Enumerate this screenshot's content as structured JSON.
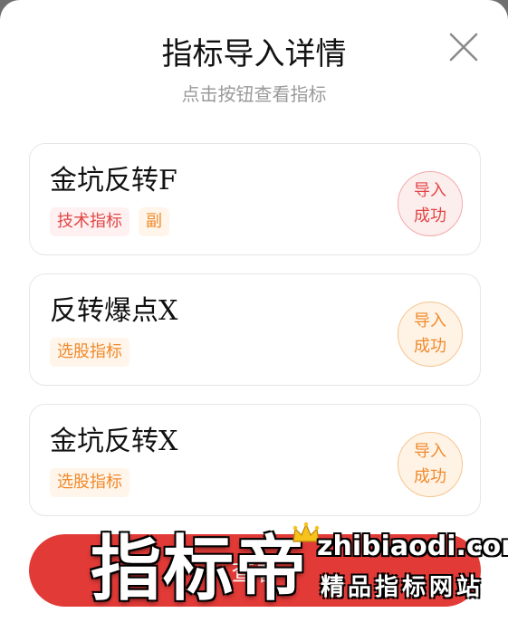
{
  "modal": {
    "title": "指标导入详情",
    "subtitle": "点击按钮查看指标"
  },
  "cards": [
    {
      "name": "金坑反转F",
      "tags": [
        {
          "label": "技术指标",
          "color": "red"
        },
        {
          "label": "副",
          "color": "orange"
        }
      ],
      "status": {
        "line1": "导入",
        "line2": "成功",
        "color": "red"
      }
    },
    {
      "name": "反转爆点X",
      "tags": [
        {
          "label": "选股指标",
          "color": "orange"
        }
      ],
      "status": {
        "line1": "导入",
        "line2": "成功",
        "color": "orange"
      }
    },
    {
      "name": "金坑反转X",
      "tags": [
        {
          "label": "选股指标",
          "color": "orange"
        }
      ],
      "status": {
        "line1": "导入",
        "line2": "成功",
        "color": "orange"
      }
    }
  ],
  "cta": {
    "label": "查看"
  },
  "watermark": {
    "big": "指标帝",
    "domain": "zhibiaodi.com",
    "sub": "精品指标网站"
  },
  "colors": {
    "accent_red": "#e23a37",
    "tag_red": "#e24545",
    "tag_orange": "#f08a2c"
  },
  "icons": {
    "close": "close-icon",
    "crown": "crown-icon"
  }
}
